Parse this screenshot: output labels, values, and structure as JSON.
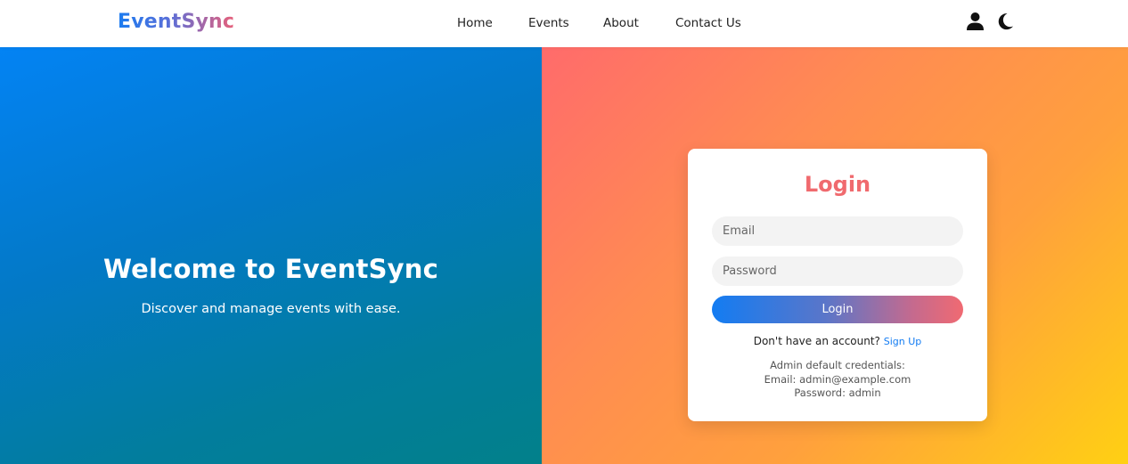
{
  "navbar": {
    "brand": "EventSync",
    "links": [
      "Home",
      "Events",
      "About",
      "Contact Us"
    ],
    "icons": [
      "user-icon",
      "moon-icon"
    ]
  },
  "hero": {
    "title": "Welcome to EventSync",
    "subtitle": "Discover and manage events with ease."
  },
  "login": {
    "title": "Login",
    "email_placeholder": "Email",
    "password_placeholder": "Password",
    "button_label": "Login",
    "signup_prompt": "Don't have an account?",
    "signup_link": "Sign Up",
    "credentials": {
      "heading": "Admin default credentials:",
      "email_line": "Email: admin@example.com",
      "password_line": "Password: admin"
    }
  },
  "colors": {
    "accent_blue": "#137cf2",
    "accent_coral": "#f06a6e",
    "left_gradient_start": "#0383f4",
    "left_gradient_end": "#02808a",
    "right_gradient_start": "#ff6b6b",
    "right_gradient_end": "#ffd013"
  }
}
